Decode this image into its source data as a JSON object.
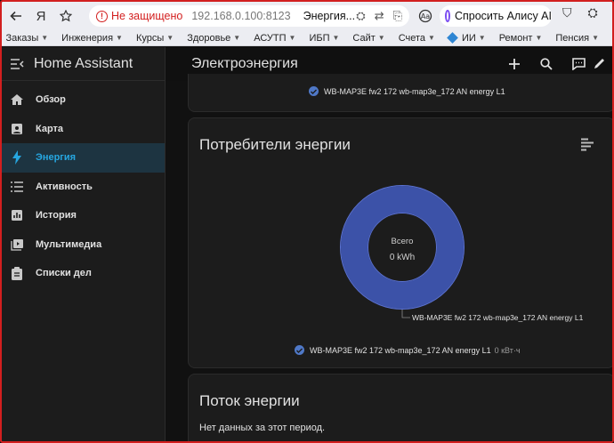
{
  "browser": {
    "not_secure": "Не защищено",
    "host": "192.168.0.100:8123",
    "tab_title": "Энергия...",
    "alice": "Спросить Алису AI"
  },
  "bookmarks": [
    {
      "label": "Заказы",
      "caret": true
    },
    {
      "label": "Инженерия",
      "caret": true
    },
    {
      "label": "Курсы",
      "caret": true
    },
    {
      "label": "Здоровье",
      "caret": true
    },
    {
      "label": "АСУТП",
      "caret": true
    },
    {
      "label": "ИБП",
      "caret": true
    },
    {
      "label": "Сайт",
      "caret": true
    },
    {
      "label": "Счета",
      "caret": true
    },
    {
      "label": "ИИ",
      "caret": true
    },
    {
      "label": "Ремонт",
      "caret": true
    },
    {
      "label": "Пенсия",
      "caret": true
    }
  ],
  "sidebar": {
    "title": "Home Assistant",
    "items": [
      {
        "label": "Обзор",
        "icon": "home-icon"
      },
      {
        "label": "Карта",
        "icon": "map-icon"
      },
      {
        "label": "Энергия",
        "icon": "lightning-icon",
        "active": true
      },
      {
        "label": "Активность",
        "icon": "list-icon"
      },
      {
        "label": "История",
        "icon": "chart-icon"
      },
      {
        "label": "Мультимедиа",
        "icon": "media-icon"
      },
      {
        "label": "Списки дел",
        "icon": "clipboard-icon"
      }
    ]
  },
  "header": {
    "title": "Электроэнергия"
  },
  "card1": {
    "legend": "WB-MAP3E fw2 172 wb-map3e_172 AN energy L1"
  },
  "consumers": {
    "title": "Потребители энергии",
    "center_label": "Всего",
    "center_value": "0 kWh",
    "slice_label": "WB-MAP3E fw2 172 wb-map3e_172 AN energy L1",
    "legend": "WB-MAP3E fw2 172 wb-map3e_172 AN energy L1",
    "legend_value": "0 кВт·ч",
    "accent": "#4a62c4"
  },
  "flow": {
    "title": "Поток энергии",
    "no_data": "Нет данных за этот период."
  }
}
